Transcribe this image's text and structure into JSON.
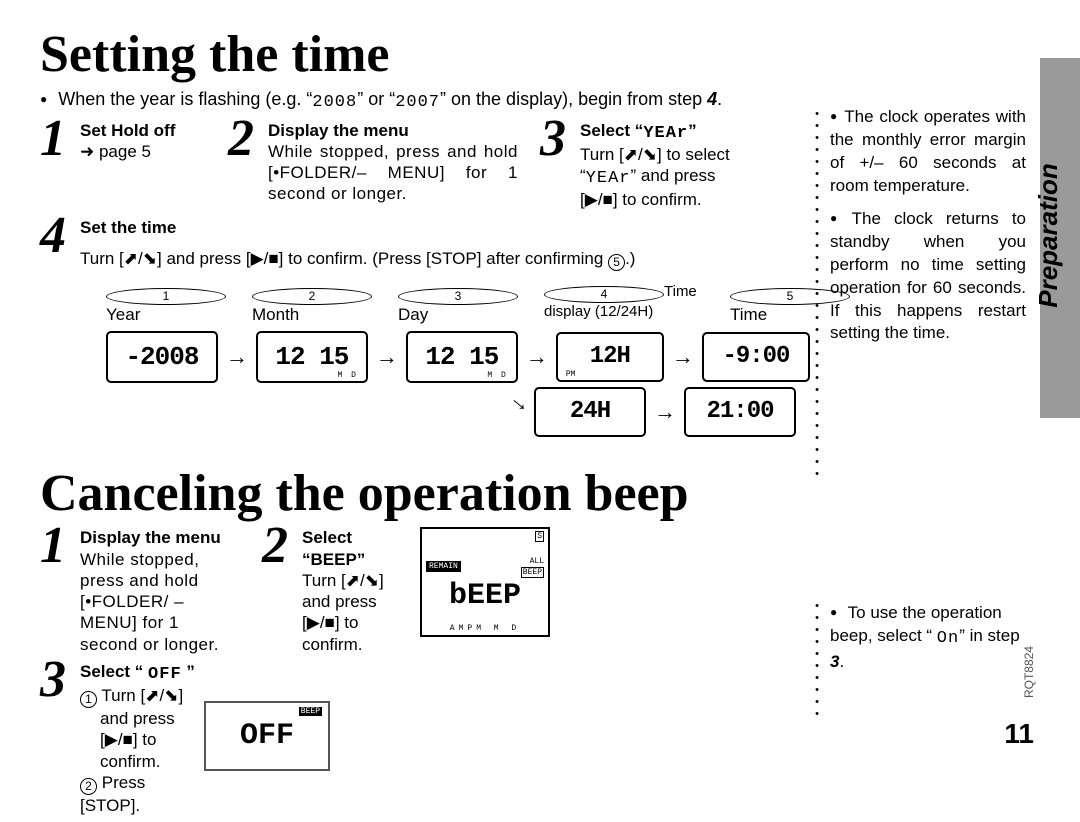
{
  "tab": {
    "label": "Preparation"
  },
  "docnum": "RQT8824",
  "title1": "Setting the time",
  "intro": {
    "lead": "When the year is flashing (e.g. “",
    "y1": "2008",
    "mid": "” or “",
    "y2": "2007",
    "tail": "” on the display), begin from step ",
    "stepref": "4",
    "end": "."
  },
  "sideA": [
    "The clock operates with the monthly error margin of +/– 60 seconds at room temperature.",
    "The clock returns to standby when you perform no time setting operation for 60 seconds. If this happens restart setting the time."
  ],
  "step1": {
    "h": "Set Hold off",
    "b1": "➜ page 5"
  },
  "step2": {
    "h": "Display the menu",
    "l1": "While stopped, press and hold [•FOLDER/– MENU] for 1 second or longer."
  },
  "step3": {
    "h_pre": "Select “",
    "h_seg": "YEAr",
    "h_post": "”",
    "l1a": "Turn [",
    "l1b": "/",
    "l1c": "] to select",
    "l2a": "“",
    "l2seg": "YEAr",
    "l2b": "” and press",
    "l3a": "[",
    "l3b": "/",
    "l3c": "] to confirm."
  },
  "step4": {
    "h": "Set the time",
    "l_a": "Turn [",
    "l_b": "/",
    "l_c": "] and press [",
    "l_d": "/",
    "l_e": "] to confirm. (Press [STOP] after confirming ",
    "l_f": ".)"
  },
  "lcdlabels": {
    "a": "Year",
    "b": "Month",
    "c": "Day",
    "d": "Time display (12/24H)",
    "e": "Time"
  },
  "lcd": {
    "year": "-2008",
    "month": "12 15",
    "day": "12 15",
    "h12": "12H",
    "h24": "24H",
    "t12": "-9:00",
    "t24": "21:00",
    "sub_md": "M   D",
    "sub_pm": "PM"
  },
  "title2": "Canceling the operation beep",
  "b_step1": {
    "h": "Display the menu",
    "l": "While stopped, press and hold [•FOLDER/ – MENU] for 1 second or longer."
  },
  "b_step2": {
    "h": "Select “BEEP”",
    "l1a": "Turn [",
    "l1b": "/",
    "l1c": "]",
    "l2": "and press",
    "l3a": "[",
    "l3b": "/",
    "l3c": "] to",
    "l4": "confirm."
  },
  "b_step3": {
    "h_pre": "Select “ ",
    "h_seg": "OFF",
    "h_post": " ”",
    "l1a": "Turn [",
    "l1b": "/",
    "l1c": "]",
    "l2": "and press",
    "l3a": "[",
    "l3b": "/",
    "l3c": "] to",
    "l4": "confirm.",
    "l5": "Press [STOP]."
  },
  "sideB": {
    "pre": "To use the operation beep, select “ ",
    "seg": "On",
    "post": "” in step ",
    "stepref": "3",
    "end": "."
  },
  "pagenum": "11",
  "lcd2": {
    "remain": "REMAIN",
    "all": "ALL",
    "beep": "BEEP",
    "big": "bEEP",
    "bot": "AMPM  M    D",
    "s": "S"
  },
  "lcd3": {
    "big": "OFF",
    "beep": "BEEP"
  }
}
